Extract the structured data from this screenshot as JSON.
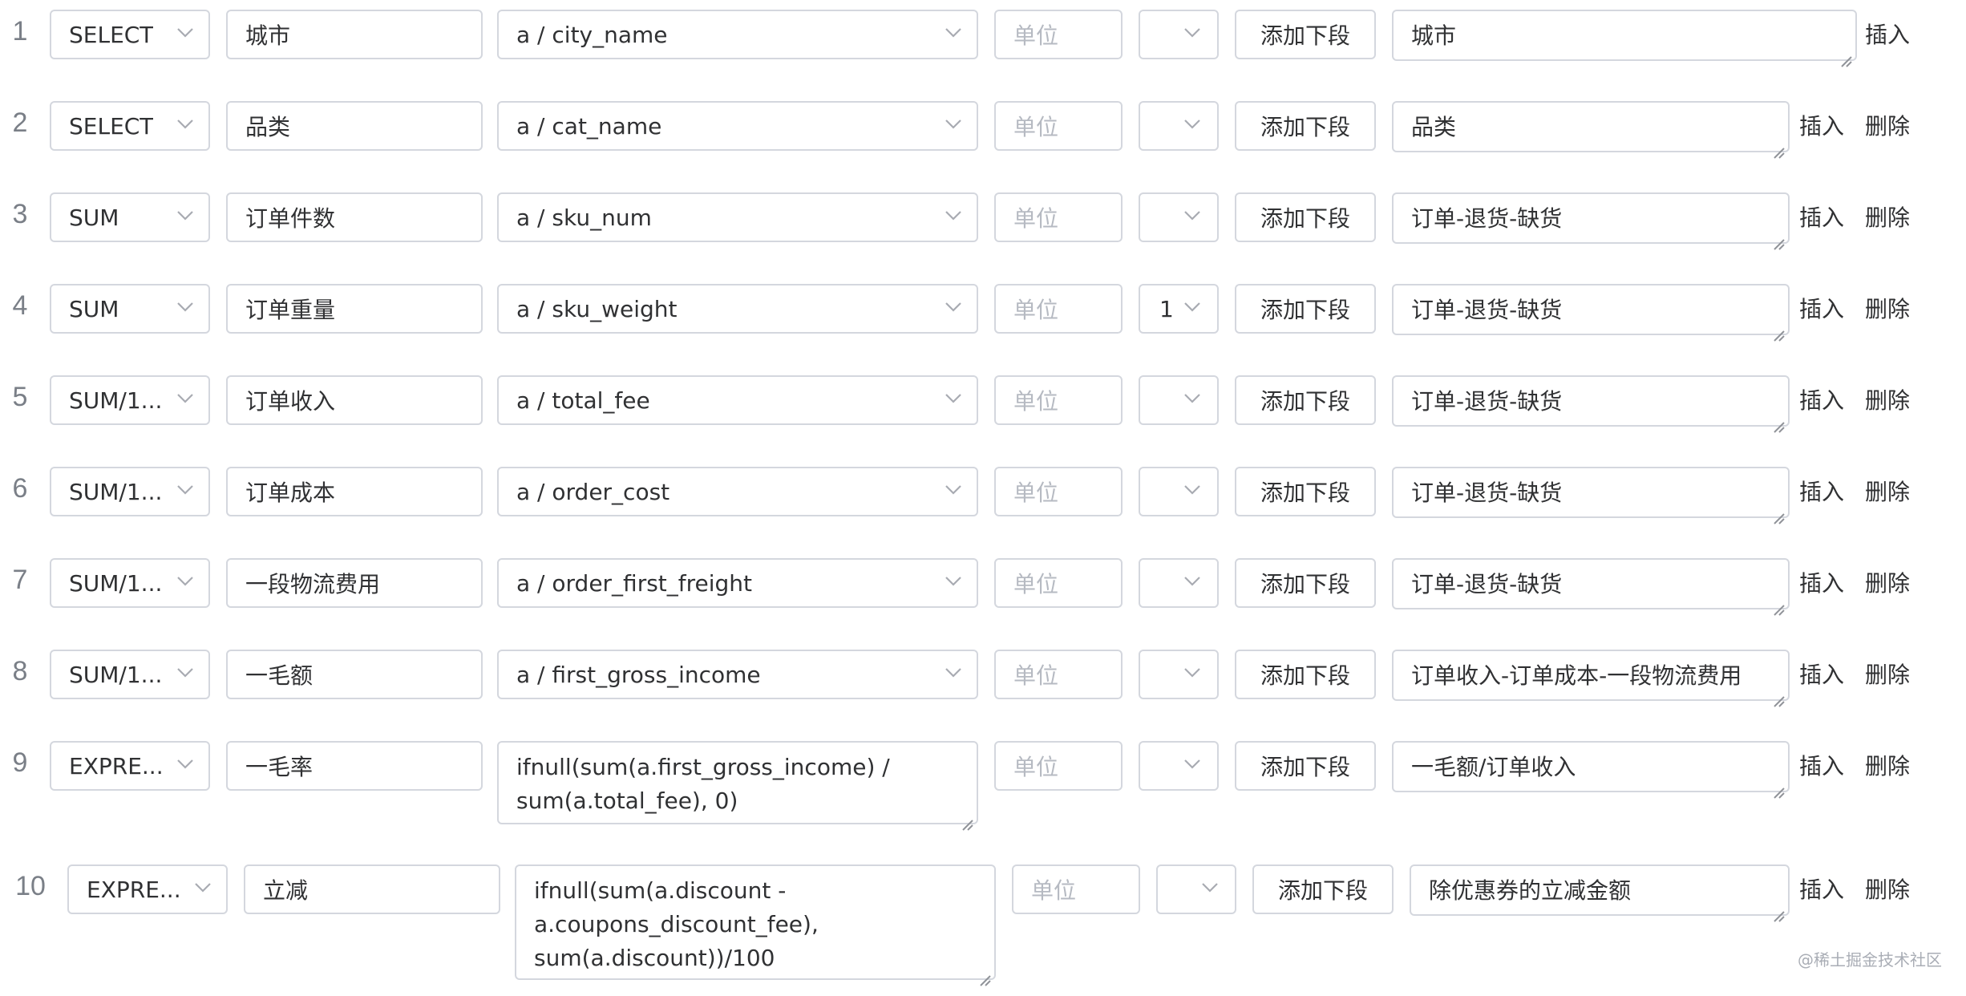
{
  "placeholder_unit": "单位",
  "add_segment_label": "添加下段",
  "insert_label": "插入",
  "delete_label": "删除",
  "watermark": "@稀土掘金技术社区",
  "rows": [
    {
      "num": "1",
      "agg": "SELECT",
      "alias": "城市",
      "field": "a / city_name",
      "unit": "",
      "multiplier": "",
      "desc": "城市",
      "has_delete": false
    },
    {
      "num": "2",
      "agg": "SELECT",
      "alias": "品类",
      "field": "a / cat_name",
      "unit": "",
      "multiplier": "",
      "desc": "品类",
      "has_delete": true
    },
    {
      "num": "3",
      "agg": "SUM",
      "alias": "订单件数",
      "field": "a / sku_num",
      "unit": "",
      "multiplier": "",
      "desc": "订单-退货-缺货",
      "has_delete": true
    },
    {
      "num": "4",
      "agg": "SUM",
      "alias": "订单重量",
      "field": "a / sku_weight",
      "unit": "",
      "multiplier": "1",
      "desc": "订单-退货-缺货",
      "has_delete": true
    },
    {
      "num": "5",
      "agg": "SUM/1...",
      "alias": "订单收入",
      "field": "a / total_fee",
      "unit": "",
      "multiplier": "",
      "desc": "订单-退货-缺货",
      "has_delete": true
    },
    {
      "num": "6",
      "agg": "SUM/1...",
      "alias": "订单成本",
      "field": "a / order_cost",
      "unit": "",
      "multiplier": "",
      "desc": "订单-退货-缺货",
      "has_delete": true
    },
    {
      "num": "7",
      "agg": "SUM/1...",
      "alias": "一段物流费用",
      "field": "a / order_first_freight",
      "unit": "",
      "multiplier": "",
      "desc": "订单-退货-缺货",
      "has_delete": true
    },
    {
      "num": "8",
      "agg": "SUM/1...",
      "alias": "一毛额",
      "field": "a / first_gross_income",
      "unit": "",
      "multiplier": "",
      "desc": "订单收入-订单成本-一段物流费用",
      "has_delete": true
    },
    {
      "num": "9",
      "agg": "EXPRE...",
      "alias": "一毛率",
      "field_lines": [
        "ifnull(sum(a.first_gross_income) /",
        "sum(a.total_fee), 0)"
      ],
      "unit": "",
      "multiplier": "",
      "desc": "一毛额/订单收入",
      "has_delete": true
    },
    {
      "num": "10",
      "agg": "EXPRE...",
      "alias": "立减",
      "field_lines": [
        "ifnull(sum(a.discount -",
        "a.coupons_discount_fee),",
        "sum(a.discount))/100"
      ],
      "unit": "",
      "multiplier": "",
      "desc": "除优惠券的立减金额",
      "has_delete": true
    }
  ]
}
